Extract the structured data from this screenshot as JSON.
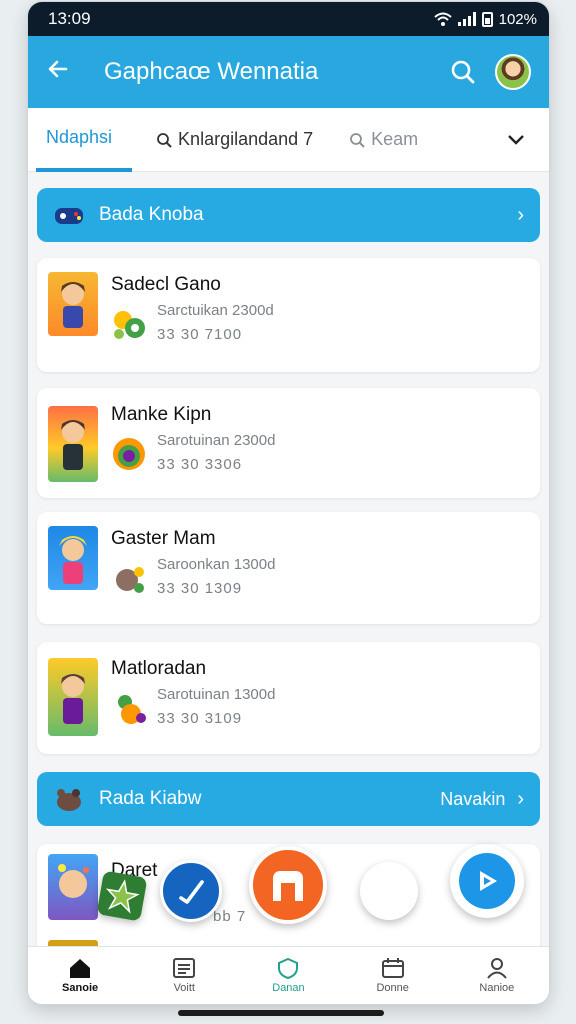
{
  "status": {
    "time": "13:09",
    "battery": "102%"
  },
  "appbar": {
    "title": "Gaphcaœ Wennatia",
    "back_icon": "arrow-left-icon",
    "search_icon": "search-icon"
  },
  "tabs": [
    {
      "label": "Ndaphsi"
    },
    {
      "label": "Knlargilandand 7"
    },
    {
      "label": "Keam"
    }
  ],
  "sections": [
    {
      "label": "Bada Knoba",
      "right": ""
    },
    {
      "label": "Rada Kiabw",
      "right": "Navakin"
    }
  ],
  "cards": [
    {
      "name": "Sadecl Gano",
      "subtitle": "Sarctuikan 2300d",
      "score": "33 30 7100"
    },
    {
      "name": "Manke Kipn",
      "subtitle": "Sarotuinan 2300d",
      "score": "33 30 3306"
    },
    {
      "name": "Gaster Mam",
      "subtitle": "Saroonkan 1300d",
      "score": "33 30 1309"
    },
    {
      "name": "Matloradan",
      "subtitle": "Sarotuinan 1300d",
      "score": "33 30 3109"
    }
  ],
  "partial_card": {
    "name": "Daret",
    "score": "bb 7"
  },
  "bottom_nav": [
    {
      "label": "Sanoie"
    },
    {
      "label": "Voitt"
    },
    {
      "label": "Danan"
    },
    {
      "label": "Donne"
    },
    {
      "label": "Nanioe"
    }
  ],
  "colors": {
    "primary": "#29a8e0",
    "accent_orange": "#f26522",
    "fab_blue": "#1565c0",
    "active_tab": "#1e97d6"
  }
}
